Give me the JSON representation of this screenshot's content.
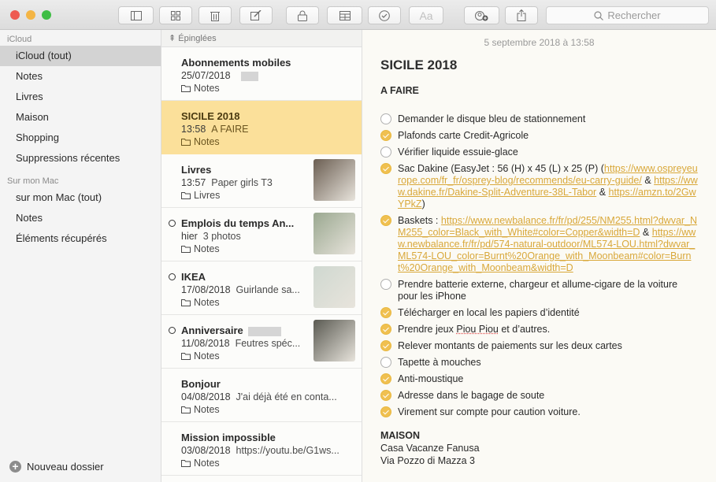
{
  "toolbar": {
    "buttons": [
      "sidebar-toggle",
      "gallery-view",
      "delete",
      "new-note",
      "lock",
      "table",
      "checklist",
      "format",
      "add-people",
      "share"
    ],
    "search_placeholder": "Rechercher"
  },
  "sidebar": {
    "sections": [
      {
        "header": "iCloud",
        "items": [
          "iCloud (tout)",
          "Notes",
          "Livres",
          "Maison",
          "Shopping",
          "Suppressions récentes"
        ]
      },
      {
        "header": "Sur mon Mac",
        "items": [
          "sur mon Mac (tout)",
          "Notes",
          "Éléments récupérés"
        ]
      }
    ],
    "selected": "iCloud (tout)",
    "new_folder_label": "Nouveau dossier"
  },
  "list": {
    "pinned_header": "Épinglées",
    "notes": [
      {
        "title": "Abonnements mobiles",
        "date": "25/07/2018",
        "preview": "",
        "folder": "Notes",
        "shared": false,
        "thumb": null
      },
      {
        "title": "SICILE 2018",
        "date": "13:58",
        "preview": "A FAIRE",
        "folder": "Notes",
        "shared": false,
        "thumb": null,
        "selected": true
      },
      {
        "title": "Livres",
        "date": "13:57",
        "preview": "Paper girls T3",
        "folder": "Livres",
        "shared": false,
        "thumb": "#6b5e52"
      },
      {
        "title": "Emplois du temps An...",
        "date": "hier",
        "preview": "3 photos",
        "folder": "Notes",
        "shared": true,
        "thumb": "#9aa890"
      },
      {
        "title": "IKEA",
        "date": "17/08/2018",
        "preview": "Guirlande sa...",
        "folder": "Notes",
        "shared": true,
        "thumb": "#cfd8d0"
      },
      {
        "title": "Anniversaire",
        "date": "11/08/2018",
        "preview": "Feutres spéc...",
        "folder": "Notes",
        "shared": true,
        "thumb": "#5a5a52"
      },
      {
        "title": "Bonjour",
        "date": "04/08/2018",
        "preview": "J'ai déjà été en conta...",
        "folder": "Notes",
        "shared": false,
        "thumb": null
      },
      {
        "title": "Mission impossible",
        "date": "03/08/2018",
        "preview": "https://youtu.be/G1ws...",
        "folder": "Notes",
        "shared": false,
        "thumb": null
      }
    ]
  },
  "editor": {
    "date": "5 septembre 2018 à 13:58",
    "title": "SICILE 2018",
    "section": "A FAIRE",
    "todos": [
      {
        "done": false,
        "parts": [
          {
            "t": "Demander le disque bleu de stationnement"
          }
        ]
      },
      {
        "done": true,
        "parts": [
          {
            "t": "Plafonds carte Credit-Agricole"
          }
        ]
      },
      {
        "done": false,
        "parts": [
          {
            "t": "Vérifier liquide essuie-glace"
          }
        ]
      },
      {
        "done": true,
        "parts": [
          {
            "t": "Sac Dakine (EasyJet : 56 (H) x 45 (L) x 25 (P) ("
          },
          {
            "l": "https://www.ospreyeurope.com/fr_fr/osprey-blog/recommends/eu-carry-guide/"
          },
          {
            "t": " & "
          },
          {
            "l": "https://www.dakine.fr/Dakine-Split-Adventure-38L-Tabor"
          },
          {
            "t": " & "
          },
          {
            "l": "https://amzn.to/2GwYPkZ"
          },
          {
            "t": ")"
          }
        ]
      },
      {
        "done": true,
        "parts": [
          {
            "t": "Baskets : "
          },
          {
            "l": "https://www.newbalance.fr/fr/pd/255/NM255.html?dwvar_NM255_color=Black_with_White#color=Copper&width=D"
          },
          {
            "t": " & "
          },
          {
            "l": "https://www.newbalance.fr/fr/pd/574-natural-outdoor/ML574-LOU.html?dwvar_ML574-LOU_color=Burnt%20Orange_with_Moonbeam#color=Burnt%20Orange_with_Moonbeam&width=D"
          }
        ]
      },
      {
        "done": false,
        "parts": [
          {
            "t": "Prendre batterie externe, chargeur et allume-cigare de la voiture pour les iPhone"
          }
        ]
      },
      {
        "done": true,
        "parts": [
          {
            "t": "Télécharger en local les papiers d’identité"
          }
        ]
      },
      {
        "done": true,
        "parts": [
          {
            "t": "Prendre jeux "
          },
          {
            "s": "Piou Piou"
          },
          {
            "t": " et d’autres."
          }
        ]
      },
      {
        "done": true,
        "parts": [
          {
            "t": "Relever montants de paiements sur les deux cartes"
          }
        ]
      },
      {
        "done": false,
        "parts": [
          {
            "t": "Tapette à mouches"
          }
        ]
      },
      {
        "done": true,
        "parts": [
          {
            "t": "Anti-moustique"
          }
        ]
      },
      {
        "done": true,
        "parts": [
          {
            "t": "Adresse dans le bagage de soute"
          }
        ]
      },
      {
        "done": true,
        "parts": [
          {
            "t": "Virement sur compte pour caution voiture."
          }
        ]
      }
    ],
    "address": {
      "title": "MAISON",
      "lines": [
        "Casa Vacanze Fanusa",
        "Via Pozzo di Mazza 3"
      ]
    }
  },
  "colors": {
    "accent": "#f0c050",
    "selected_note": "#fbe09a",
    "link": "#d9a83a"
  }
}
